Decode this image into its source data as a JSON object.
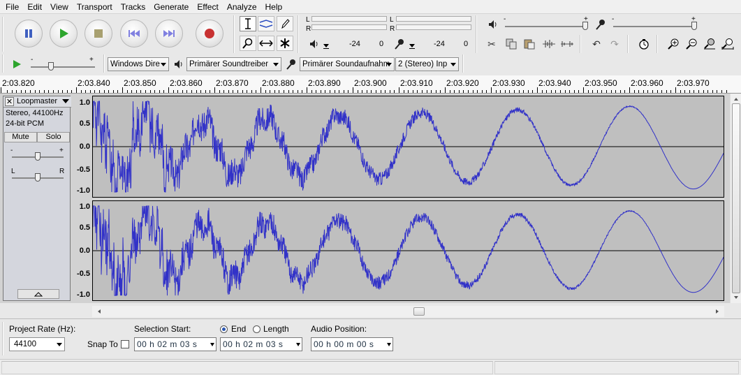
{
  "menu": [
    "File",
    "Edit",
    "View",
    "Transport",
    "Tracks",
    "Generate",
    "Effect",
    "Analyze",
    "Help"
  ],
  "meters": {
    "playback": {
      "left": "L",
      "right": "R",
      "ticks": [
        "-24",
        "0"
      ]
    },
    "record": {
      "left": "L",
      "right": "R",
      "ticks": [
        "-24",
        "0"
      ]
    }
  },
  "mixer": {
    "min_label": "-",
    "max_label": "+"
  },
  "device": {
    "host": "Windows Dire",
    "playback": "Primärer Soundtreiber",
    "recording": "Primärer Soundaufnahm",
    "channels": "2 (Stereo) Inp"
  },
  "ruler": {
    "labels": [
      "2:03.820",
      "2:03.840",
      "2:03.850",
      "2:03.860",
      "2:03.870",
      "2:03.880",
      "2:03.890",
      "2:03.900",
      "2:03.910",
      "2:03.920",
      "2:03.930",
      "2:03.940",
      "2:03.950",
      "2:03.960",
      "2:03.970"
    ]
  },
  "track": {
    "name": "Loopmaster",
    "format": "Stereo, 44100Hz",
    "bits": "24-bit PCM",
    "mute": "Mute",
    "solo": "Solo",
    "gain_min": "-",
    "gain_max": "+",
    "pan_left": "L",
    "pan_right": "R",
    "scale": [
      "1.0",
      "0.5",
      "0.0",
      "-0.5",
      "-1.0"
    ]
  },
  "selection": {
    "project_rate_label": "Project Rate (Hz):",
    "project_rate": "44100",
    "snap_label": "Snap To",
    "start_label": "Selection Start:",
    "end_label": "End",
    "length_label": "Length",
    "start_value": "00 h 02 m 03 s",
    "end_value": "00 h 02 m 03 s",
    "position_label": "Audio Position:",
    "position_value": "00 h 00 m 00 s"
  },
  "colors": {
    "waveform": "#3232c8",
    "wave_bg": "#bfbfbf",
    "play": "#2da52d",
    "record": "#c83232",
    "transport_blue": "#4060c0"
  }
}
